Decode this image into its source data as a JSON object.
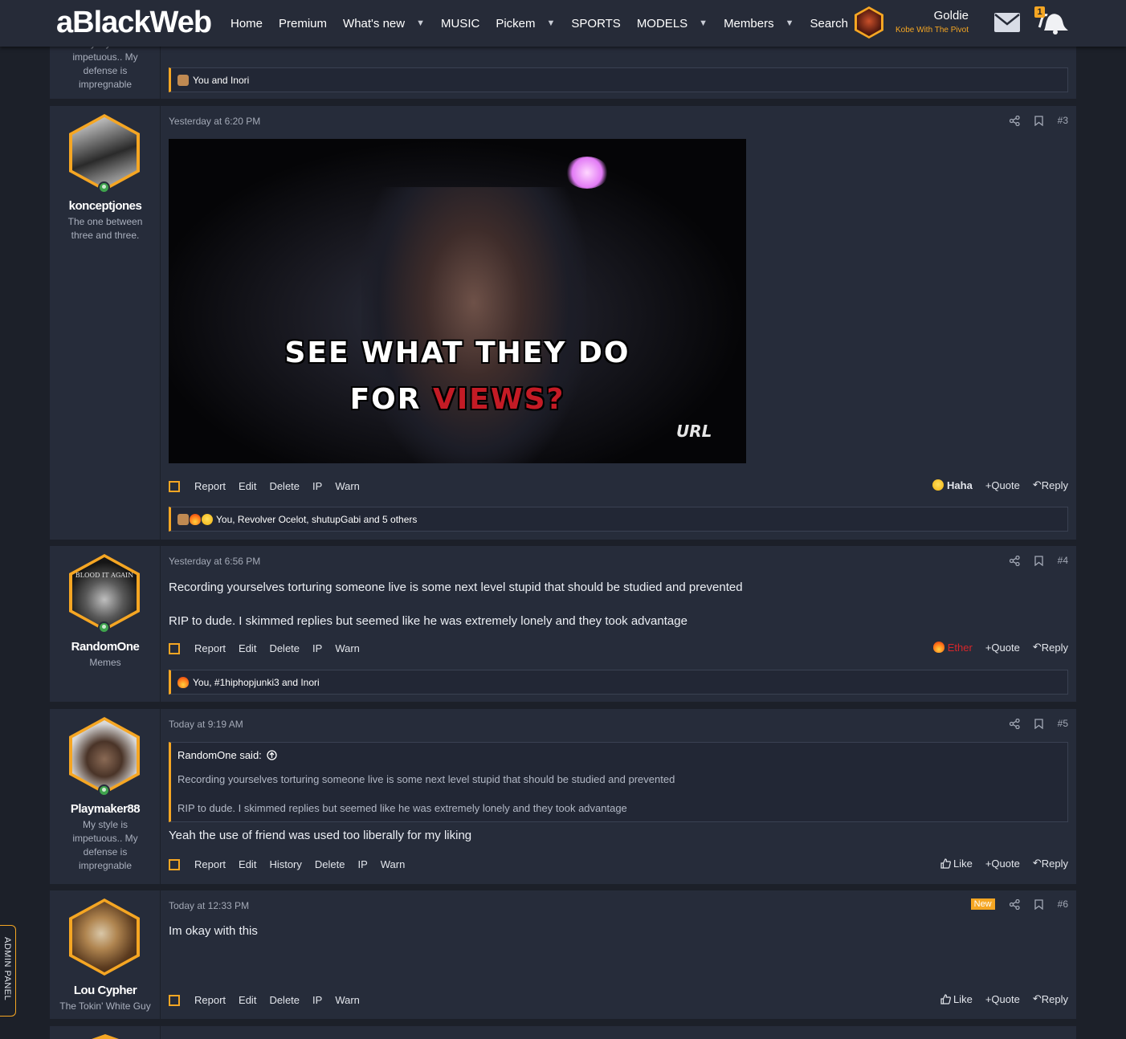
{
  "header": {
    "logo": "aBlackWeb",
    "nav": [
      {
        "label": "Home",
        "caret": false
      },
      {
        "label": "Premium",
        "caret": false
      },
      {
        "label": "What's new",
        "caret": true
      },
      {
        "label": "MUSIC",
        "caret": false
      },
      {
        "label": "Pickem",
        "caret": true
      },
      {
        "label": "SPORTS",
        "caret": false
      },
      {
        "label": "MODELS",
        "caret": true
      },
      {
        "label": "Members",
        "caret": true
      },
      {
        "label": "Search",
        "caret": false
      }
    ],
    "user": {
      "name": "Goldie",
      "title": "Kobe With The Pivot"
    },
    "alerts_count": "1"
  },
  "colors": {
    "accent": "#f5a623",
    "background": "#1c2029",
    "panel": "#262c3a",
    "ether": "#d7262a"
  },
  "prev_post": {
    "user_title": "My style is impetuous.. My defense is impregnable",
    "reactions": "You and Inori"
  },
  "posts": [
    {
      "number": "#3",
      "date": "Yesterday at 6:20 PM",
      "username": "konceptjones",
      "user_title": "The one between three and three.",
      "gif_caption_line1": "SEE WHAT THEY DO",
      "gif_caption_line2a": "FOR ",
      "gif_caption_line2b": "VIEWS?",
      "gif_watermark": "URL",
      "actions": [
        "Report",
        "Edit",
        "Delete",
        "IP",
        "Warn"
      ],
      "reaction_button": "Haha",
      "quote": "Quote",
      "reply": "Reply",
      "reactions": "You, Revolver Ocelot, shutupGabi and 5 others"
    },
    {
      "number": "#4",
      "date": "Yesterday at 6:56 PM",
      "username": "RandomOne",
      "user_title": "Memes",
      "avatar_text": "BLOOD IT AGAIN",
      "text1": "Recording yourselves torturing someone live is some next level stupid that should be studied and prevented",
      "text2": "RIP to dude. I skimmed replies but seemed like he was extremely lonely and they took advantage",
      "actions": [
        "Report",
        "Edit",
        "Delete",
        "IP",
        "Warn"
      ],
      "reaction_button": "Ether",
      "quote": "Quote",
      "reply": "Reply",
      "reactions": "You, #1hiphopjunki3 and Inori"
    },
    {
      "number": "#5",
      "date": "Today at 9:19 AM",
      "username": "Playmaker88",
      "user_title": "My style is impetuous.. My defense is impregnable",
      "quote_author": "RandomOne said:",
      "quote_line1": "Recording yourselves torturing someone live is some next level stupid that should be studied and prevented",
      "quote_line2": "RIP to dude. I skimmed replies but seemed like he was extremely lonely and they took advantage",
      "text": "Yeah the use of friend was used too liberally for my liking",
      "actions": [
        "Report",
        "Edit",
        "History",
        "Delete",
        "IP",
        "Warn"
      ],
      "reaction_button": "Like",
      "quote": "Quote",
      "reply": "Reply"
    },
    {
      "number": "#6",
      "badge": "New",
      "date": "Today at 12:33 PM",
      "username": "Lou Cypher",
      "user_title": "The Tokin' White Guy",
      "text": "Im okay with this",
      "actions": [
        "Report",
        "Edit",
        "Delete",
        "IP",
        "Warn"
      ],
      "reaction_button": "Like",
      "quote": "Quote",
      "reply": "Reply"
    }
  ],
  "admin_panel": "ADMIN PANEL"
}
